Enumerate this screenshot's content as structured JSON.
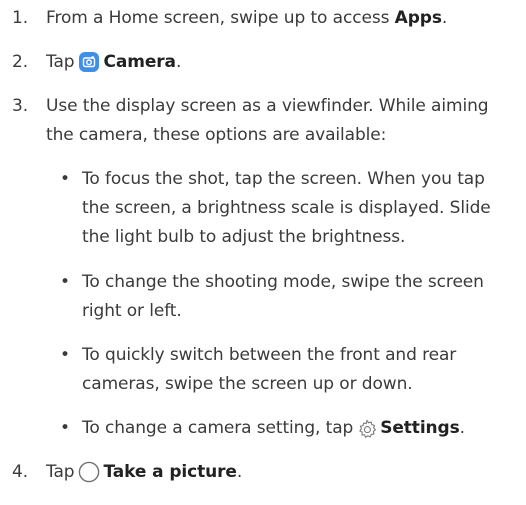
{
  "steps": [
    {
      "num": "1.",
      "text": "From a Home screen, swipe up to access ",
      "bold": "Apps",
      "suffix": "."
    },
    {
      "num": "2.",
      "pre": "Tap",
      "bold": "Camera",
      "suffix": ".",
      "icon": "camera-app-icon"
    },
    {
      "num": "3.",
      "text": "Use the display screen as a viewfinder. While aiming the camera, these options are available:"
    },
    {
      "num": "4.",
      "pre": "Tap",
      "bold": "Take a picture",
      "suffix": ".",
      "icon": "shutter-button-icon"
    }
  ],
  "bullets": [
    {
      "text": "To focus the shot, tap the screen. When you tap the screen, a brightness scale is displayed. Slide the light bulb to adjust the brightness."
    },
    {
      "text": "To change the shooting mode, swipe the screen right or left."
    },
    {
      "text": "To quickly switch between the front and rear cameras, swipe the screen up or down."
    },
    {
      "pre": "To change a camera setting, tap",
      "bold": "Settings",
      "suffix": ".",
      "icon": "gear-icon"
    }
  ],
  "bullet_symbol": "•",
  "colors": {
    "text": "#3a3a3a",
    "camera_icon": "#3f8fe8"
  }
}
